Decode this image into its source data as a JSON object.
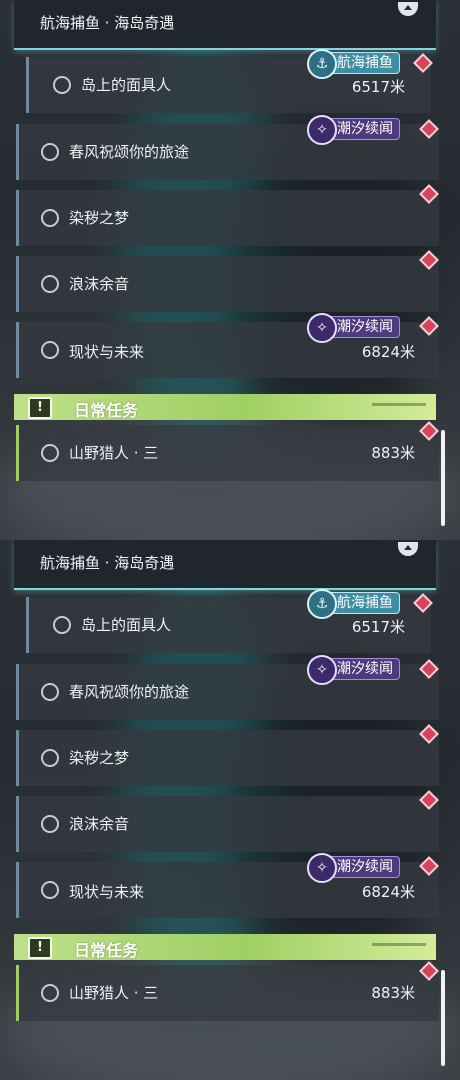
{
  "panels": [
    {
      "header": {
        "title": "航海捕鱼 · 海岛奇遇"
      },
      "quests": [
        {
          "name": "岛上的面具人",
          "distance": "6517米",
          "tag": "航海捕鱼"
        },
        {
          "name": "春风祝颂你的旅途",
          "distance": "",
          "tag": "潮汐续闻"
        },
        {
          "name": "染秽之梦",
          "distance": "",
          "tag": ""
        },
        {
          "name": "浪沫余音",
          "distance": "",
          "tag": ""
        },
        {
          "name": "现状与未来",
          "distance": "6824米",
          "tag": "潮汐续闻"
        }
      ],
      "daily": {
        "label": "日常任务",
        "icon_text": "!"
      },
      "daily_quests": [
        {
          "name": "山野猎人 · 三",
          "distance": "883米"
        }
      ]
    },
    {
      "header": {
        "title": "航海捕鱼 · 海岛奇遇"
      },
      "quests": [
        {
          "name": "岛上的面具人",
          "distance": "6517米",
          "tag": "航海捕鱼"
        },
        {
          "name": "春风祝颂你的旅途",
          "distance": "",
          "tag": "潮汐续闻"
        },
        {
          "name": "染秽之梦",
          "distance": "",
          "tag": ""
        },
        {
          "name": "浪沫余音",
          "distance": "",
          "tag": ""
        },
        {
          "name": "现状与未来",
          "distance": "6824米",
          "tag": "潮汐续闻"
        }
      ],
      "daily": {
        "label": "日常任务",
        "icon_text": "!"
      },
      "daily_quests": [
        {
          "name": "山野猎人 · 三",
          "distance": "883米"
        }
      ]
    }
  ],
  "icons": {
    "fishing_tag": "anchor-fish-icon",
    "tide_tag": "swirl-icon",
    "quest_marker": "red-diamond-marker-icon",
    "daily": "exclamation-icon",
    "collapse": "chevron-up-icon"
  },
  "colors": {
    "header_accent": "#7fd6e0",
    "fishing_tag": "#3e8ea4",
    "tide_tag": "#4d3b7e",
    "marker": "#d9425a",
    "daily_bar": "#9fcf63"
  }
}
